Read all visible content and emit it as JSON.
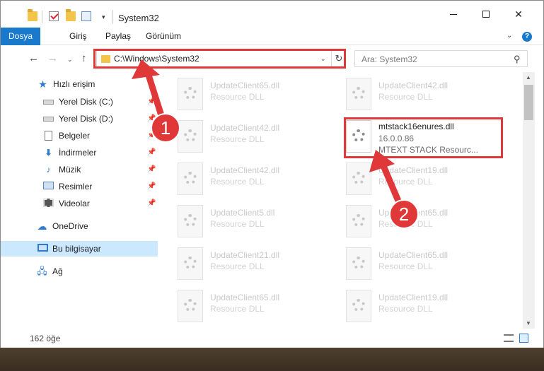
{
  "window": {
    "title": "System32"
  },
  "titlebar": {
    "minimize_glyph": "",
    "close_glyph": "✕",
    "dropdown_glyph": "▾"
  },
  "ribbon": {
    "tabs": [
      "Dosya",
      "Giriş",
      "Paylaş",
      "Görünüm"
    ],
    "expand_glyph": "⌄",
    "help_glyph": "?"
  },
  "nav": {
    "back_glyph": "←",
    "forward_glyph": "→",
    "recent_glyph": "⌄",
    "up_glyph": "↑",
    "address": "C:\\Windows\\System32",
    "address_dd_glyph": "⌄",
    "refresh_glyph": "↻",
    "search_placeholder": "Ara: System32",
    "search_glyph": "⚲"
  },
  "sidebar": {
    "quick_access": "Hızlı erişim",
    "items": [
      {
        "label": "Yerel Disk (C:)",
        "icon": "drive-icon",
        "pinned": true
      },
      {
        "label": "Yerel Disk (D:)",
        "icon": "drive-icon",
        "pinned": true
      },
      {
        "label": "Belgeler",
        "icon": "documents-icon",
        "pinned": true
      },
      {
        "label": "İndirmeler",
        "icon": "downloads-icon",
        "pinned": true
      },
      {
        "label": "Müzik",
        "icon": "music-icon",
        "pinned": true
      },
      {
        "label": "Resimler",
        "icon": "pictures-icon",
        "pinned": true
      },
      {
        "label": "Videolar",
        "icon": "videos-icon",
        "pinned": true
      }
    ],
    "onedrive": "OneDrive",
    "this_pc": "Bu bilgisayar",
    "network": "Ağ",
    "pin_glyph": "📌"
  },
  "files": [
    {
      "name": "UpdateClient65.dll",
      "type": "Resource DLL"
    },
    {
      "name": "UpdateClient42.dll",
      "type": "Resource DLL"
    },
    {
      "name": "UpdateClient42.dll",
      "type": "Resource DLL"
    },
    {
      "name": "mtstack16enures.dll",
      "version": "16.0.0.86",
      "description": "MTEXT STACK Resourc...",
      "highlighted": true
    },
    {
      "name": "UpdateClient42.dll",
      "type": "Resource DLL"
    },
    {
      "name": "UpdateClient19.dll",
      "type": "Resource DLL"
    },
    {
      "name": "UpdateClient5.dll",
      "type": "Resource DLL"
    },
    {
      "name": "UpdateClient65.dll",
      "type": "Resource DLL"
    },
    {
      "name": "UpdateClient21.dll",
      "type": "Resource DLL"
    },
    {
      "name": "UpdateClient65.dll",
      "type": "Resource DLL"
    },
    {
      "name": "UpdateClient65.dll",
      "type": "Resource DLL"
    },
    {
      "name": "UpdateClient19.dll",
      "type": "Resource DLL"
    },
    {
      "name": "",
      "type": ""
    },
    {
      "name": "",
      "type": ""
    }
  ],
  "status": {
    "item_count": "162 öğe"
  },
  "annotations": {
    "step1": "1",
    "step2": "2",
    "color": "#e03838"
  },
  "colors": {
    "accent": "#1979ca",
    "selection": "#cce8ff"
  }
}
